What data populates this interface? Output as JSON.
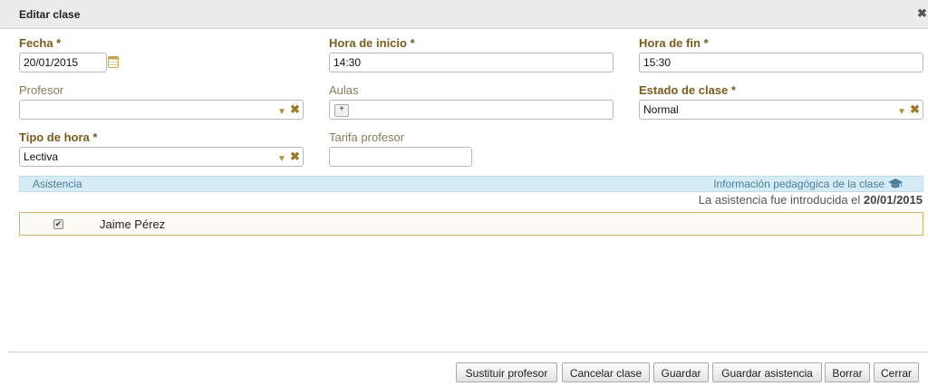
{
  "dialog": {
    "title": "Editar clase",
    "close_glyph": "✖"
  },
  "form": {
    "fecha": {
      "label": "Fecha *",
      "value": "20/01/2015"
    },
    "hora_inicio": {
      "label": "Hora de inicio *",
      "value": "14:30"
    },
    "hora_fin": {
      "label": "Hora de fin *",
      "value": "15:30"
    },
    "profesor": {
      "label": "Profesor",
      "value": ""
    },
    "aulas": {
      "label": "Aulas",
      "add_glyph": "+"
    },
    "estado": {
      "label": "Estado de clase *",
      "value": "Normal"
    },
    "tipo_hora": {
      "label": "Tipo de hora *",
      "value": "Lectiva"
    },
    "tarifa": {
      "label": "Tarifa profesor",
      "value": ""
    }
  },
  "icons": {
    "dropdown_arrow": "▼",
    "clear": "✖",
    "check": "✔"
  },
  "attendance": {
    "section_label": "Asistencia",
    "pedagogical_link": "Información pedagógica de la clase",
    "intro_prefix": "La asistencia fue introducida el ",
    "intro_date": "20/01/2015",
    "students": [
      {
        "name": "Jaime Pérez",
        "checked": true
      }
    ]
  },
  "colors": {
    "accent": "#7a5c1e",
    "info_band": "#d5ebf5",
    "info_text": "#4a7f99"
  },
  "buttons": {
    "sustituir": "Sustituir profesor",
    "cancelar_clase": "Cancelar clase",
    "guardar": "Guardar",
    "guardar_asistencia": "Guardar asistencia",
    "borrar": "Borrar",
    "cerrar": "Cerrar"
  }
}
